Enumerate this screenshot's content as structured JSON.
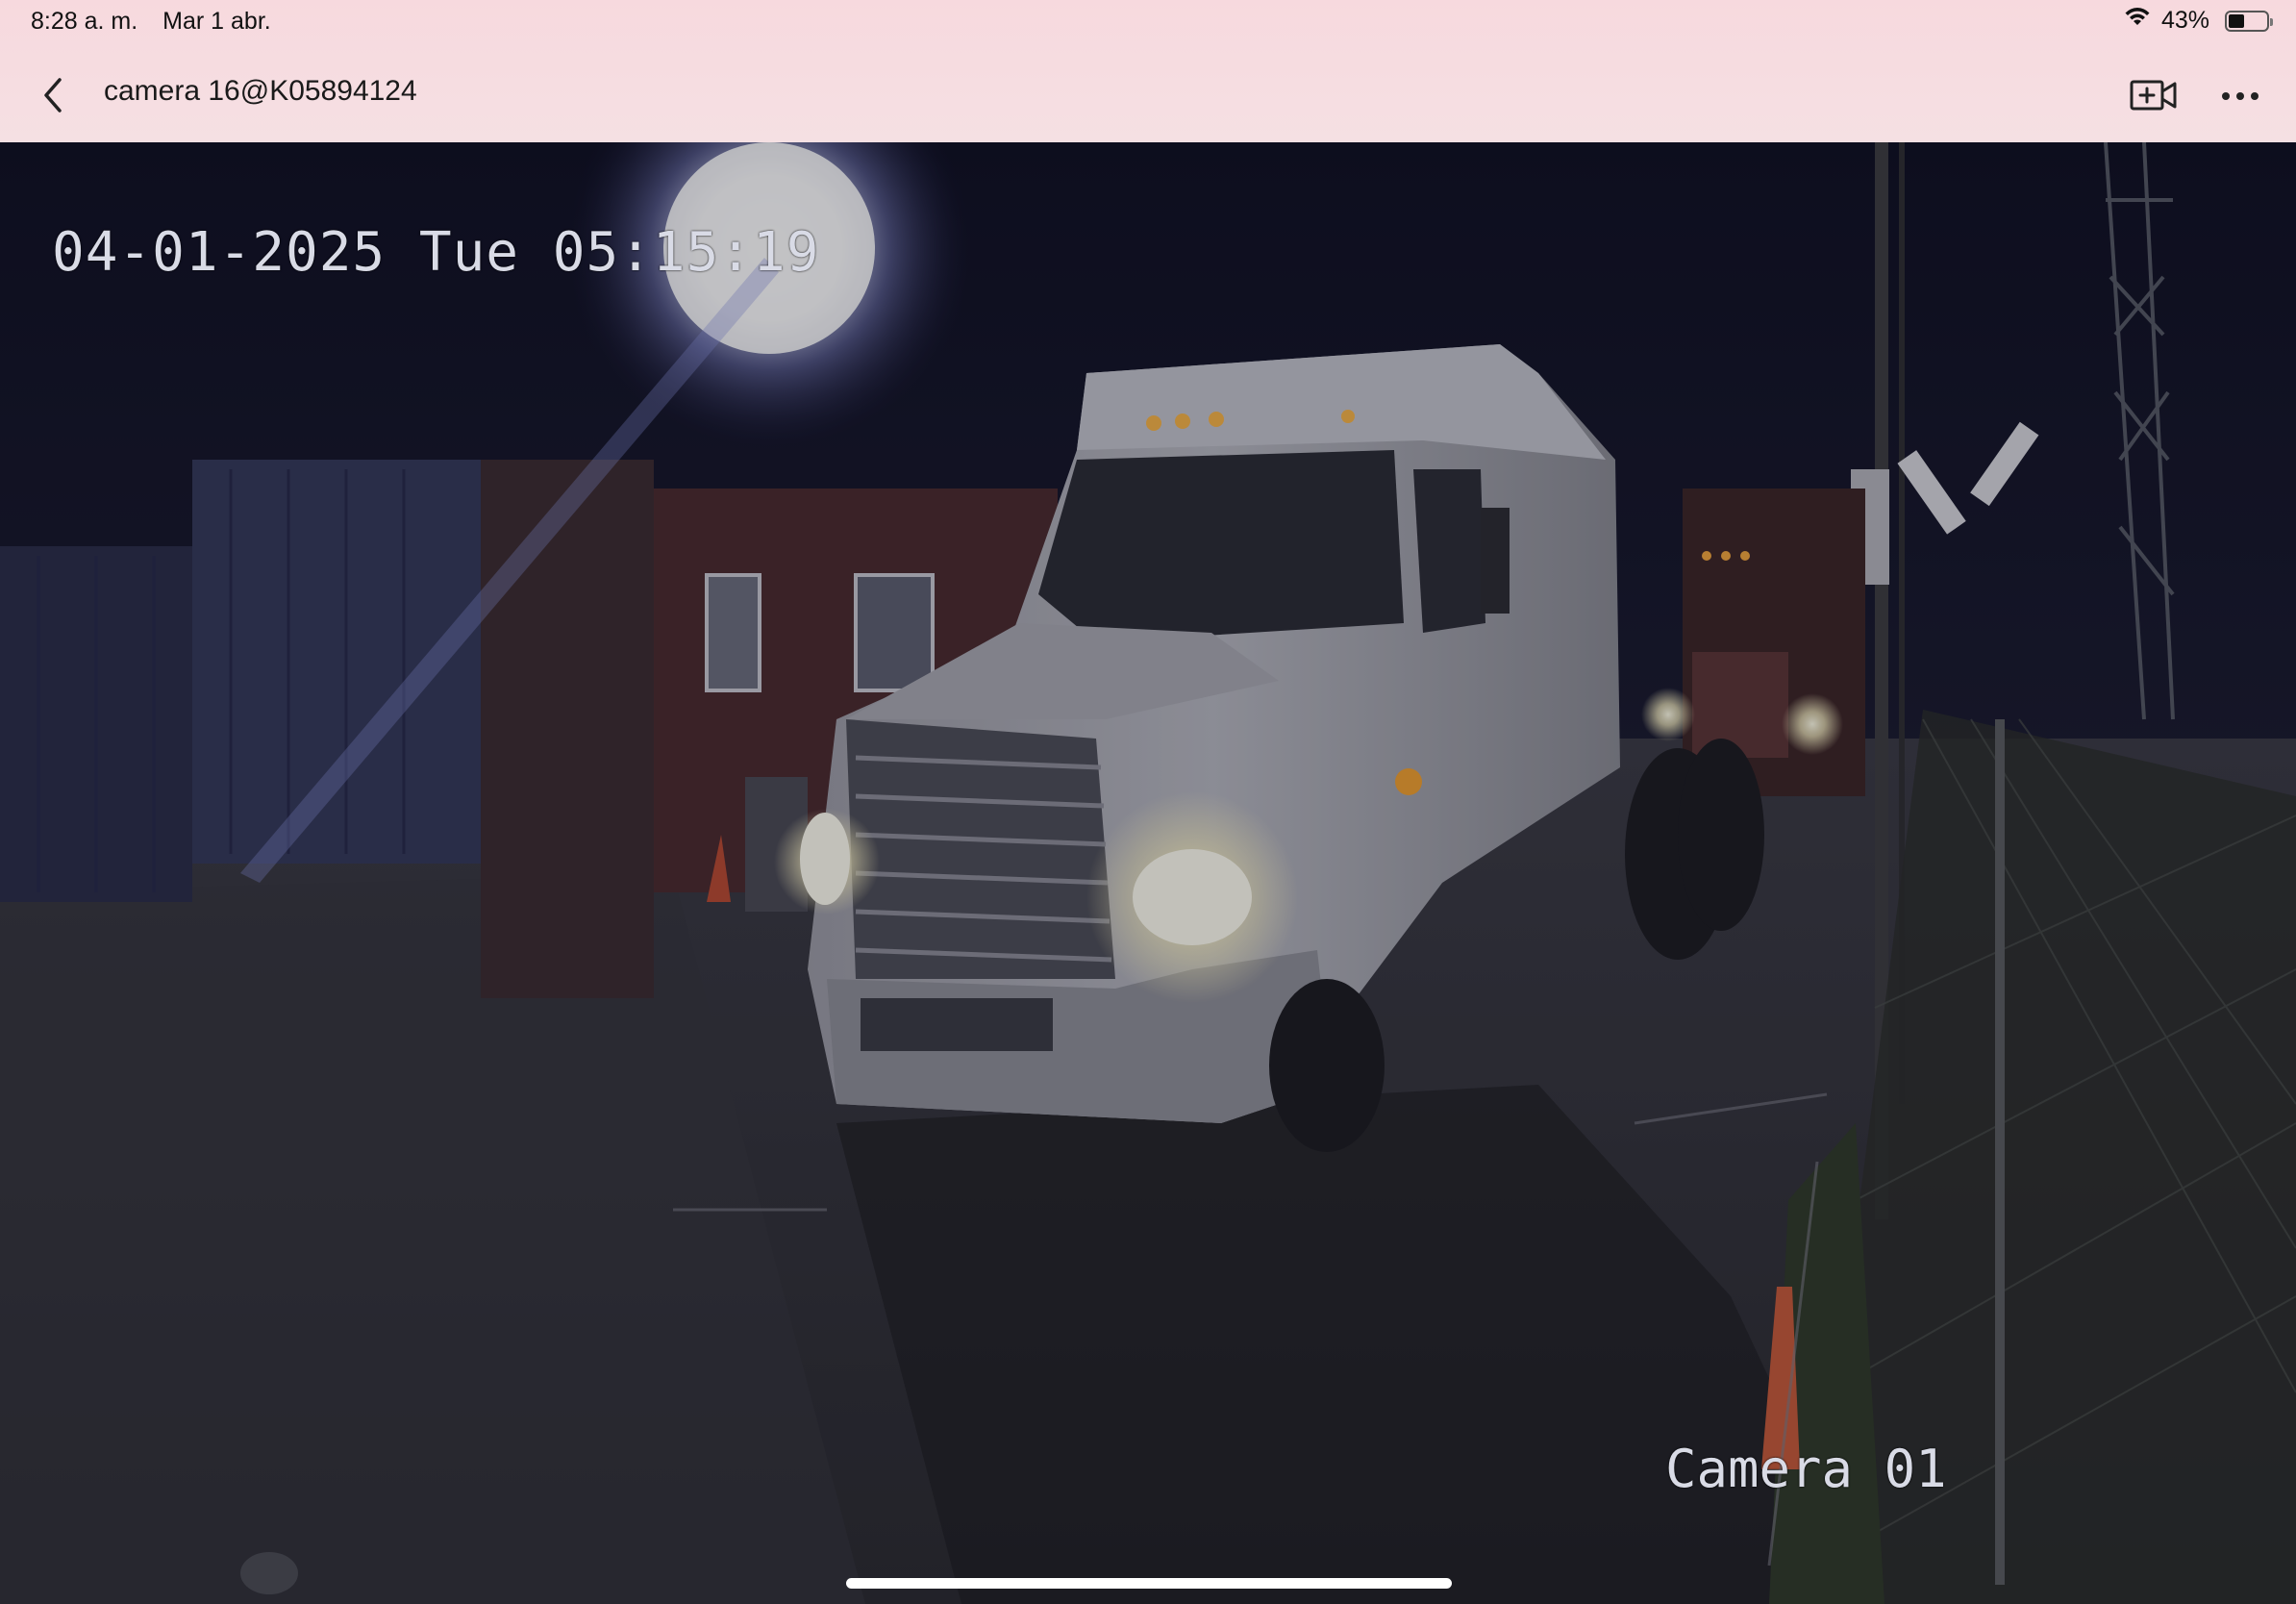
{
  "status_bar": {
    "time": "8:28 a. m.",
    "date": "Mar 1 abr.",
    "battery": "43%",
    "battery_level": 0.43,
    "wifi_icon": "wifi-icon",
    "battery_icon": "battery-icon"
  },
  "nav": {
    "back_icon": "chevron-left-icon",
    "title": "camera 16@K05894124",
    "record_icon": "video-add-icon",
    "more_icon": "ellipsis-icon"
  },
  "feed": {
    "timestamp": "04-01-2025 Tue 05:15:19",
    "camera_label": "Camera 01"
  },
  "colors": {
    "header_bg": "#f7d9de",
    "osd_text": "#d9dbe6"
  }
}
